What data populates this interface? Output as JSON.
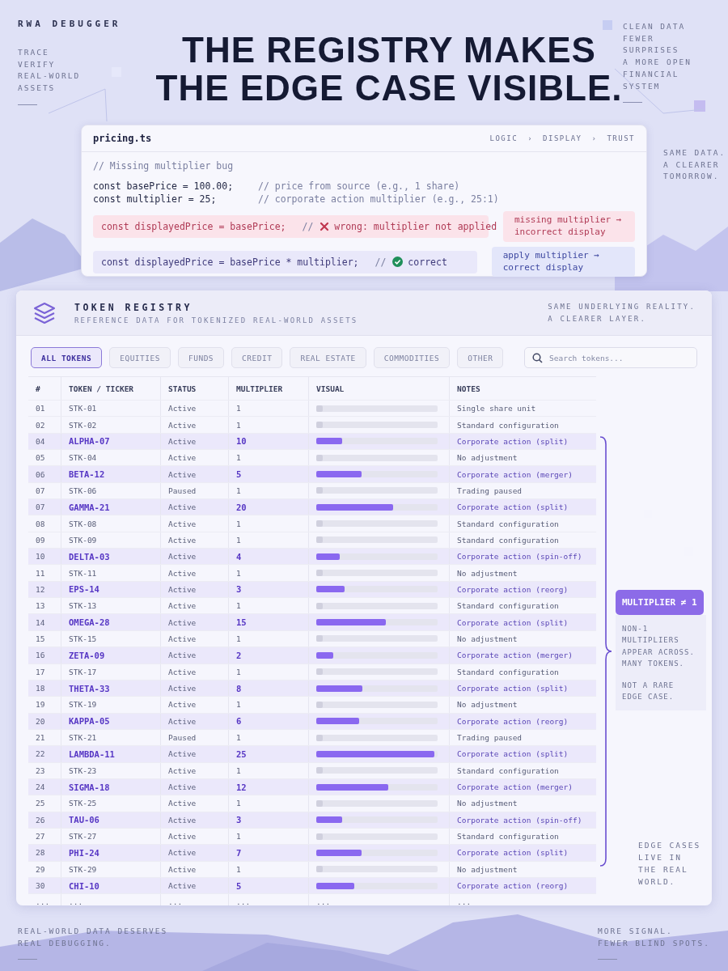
{
  "brand": "RWA DEBUGGER",
  "tagline": "TRACE\nVERIFY\nREAL-WORLD\nASSETS",
  "headline": "THE REGISTRY MAKES\nTHE EDGE CASE VISIBLE.",
  "top_note": "CLEAN DATA\nFEWER SURPRISES\nA MORE OPEN\nFINANCIAL SYSTEM",
  "side_note": "SAME DATA.\nA CLEARER\nTOMORROW.",
  "code_card": {
    "filename": "pricing.ts",
    "breadcrumb": [
      "LOGIC",
      "›",
      "DISPLAY",
      "›",
      "TRUST"
    ],
    "lines": [
      {
        "kind": "comment",
        "code": "// Missing multiplier bug"
      },
      {
        "kind": "plain",
        "code": "const basePrice = 100.00;",
        "comment": "// price from source (e.g., 1 share)"
      },
      {
        "kind": "plain",
        "code": "const multiplier = 25;",
        "comment": "// corporate action multiplier (e.g., 25:1)"
      },
      {
        "kind": "wrong",
        "code": "const displayedPrice = basePrice;",
        "comment_mark": "//",
        "comment": "wrong: multiplier not applied",
        "note": "missing multiplier →\nincorrect display"
      },
      {
        "kind": "correct",
        "code": "const displayedPrice = basePrice * multiplier;",
        "comment_mark": "//",
        "comment": "correct",
        "note": "apply multiplier →\ncorrect display"
      }
    ]
  },
  "registry": {
    "title": "TOKEN REGISTRY",
    "subtitle": "REFERENCE DATA FOR TOKENIZED REAL-WORLD ASSETS",
    "aside": "SAME UNDERLYING REALITY.\nA CLEARER LAYER.",
    "tabs": [
      {
        "label": "ALL TOKENS",
        "selected": true
      },
      {
        "label": "EQUITIES",
        "selected": false
      },
      {
        "label": "FUNDS",
        "selected": false
      },
      {
        "label": "CREDIT",
        "selected": false
      },
      {
        "label": "REAL ESTATE",
        "selected": false
      },
      {
        "label": "COMMODITIES",
        "selected": false
      },
      {
        "label": "OTHER",
        "selected": false
      }
    ],
    "search": {
      "placeholder": "Search tokens..."
    },
    "columns": [
      "#",
      "TOKEN / TICKER",
      "STATUS",
      "MULTIPLIER",
      "VISUAL",
      "NOTES"
    ],
    "rows": [
      {
        "n": "01",
        "token": "STK-01",
        "status": "Active",
        "multiplier": "1",
        "level": 0.05,
        "notes": "Single share unit",
        "flagged": false
      },
      {
        "n": "02",
        "token": "STK-02",
        "status": "Active",
        "multiplier": "1",
        "level": 0.05,
        "notes": "Standard configuration",
        "flagged": false
      },
      {
        "n": "04",
        "token": "ALPHA-07",
        "status": "Active",
        "multiplier": "10",
        "level": 0.21,
        "notes": "Corporate action (split)",
        "flagged": true
      },
      {
        "n": "05",
        "token": "STK-04",
        "status": "Active",
        "multiplier": "1",
        "level": 0.05,
        "notes": "No adjustment",
        "flagged": false
      },
      {
        "n": "06",
        "token": "BETA-12",
        "status": "Active",
        "multiplier": "5",
        "level": 0.37,
        "notes": "Corporate action (merger)",
        "flagged": true
      },
      {
        "n": "07",
        "token": "STK-06",
        "status": "Paused",
        "multiplier": "1",
        "level": 0.05,
        "notes": "Trading paused",
        "flagged": false
      },
      {
        "n": "07",
        "token": "GAMMA-21",
        "status": "Active",
        "multiplier": "20",
        "level": 0.63,
        "notes": "Corporate action (split)",
        "flagged": true
      },
      {
        "n": "08",
        "token": "STK-08",
        "status": "Active",
        "multiplier": "1",
        "level": 0.05,
        "notes": "Standard configuration",
        "flagged": false
      },
      {
        "n": "09",
        "token": "STK-09",
        "status": "Active",
        "multiplier": "1",
        "level": 0.05,
        "notes": "Standard configuration",
        "flagged": false
      },
      {
        "n": "10",
        "token": "DELTA-03",
        "status": "Active",
        "multiplier": "4",
        "level": 0.19,
        "notes": "Corporate action (spin-off)",
        "flagged": true
      },
      {
        "n": "11",
        "token": "STK-11",
        "status": "Active",
        "multiplier": "1",
        "level": 0.05,
        "notes": "No adjustment",
        "flagged": false
      },
      {
        "n": "12",
        "token": "EPS-14",
        "status": "Active",
        "multiplier": "3",
        "level": 0.23,
        "notes": "Corporate action (reorg)",
        "flagged": true
      },
      {
        "n": "13",
        "token": "STK-13",
        "status": "Active",
        "multiplier": "1",
        "level": 0.05,
        "notes": "Standard configuration",
        "flagged": false
      },
      {
        "n": "14",
        "token": "OMEGA-28",
        "status": "Active",
        "multiplier": "15",
        "level": 0.57,
        "notes": "Corporate action (split)",
        "flagged": true
      },
      {
        "n": "15",
        "token": "STK-15",
        "status": "Active",
        "multiplier": "1",
        "level": 0.05,
        "notes": "No adjustment",
        "flagged": false
      },
      {
        "n": "16",
        "token": "ZETA-09",
        "status": "Active",
        "multiplier": "2",
        "level": 0.14,
        "notes": "Corporate action (merger)",
        "flagged": true
      },
      {
        "n": "17",
        "token": "STK-17",
        "status": "Active",
        "multiplier": "1",
        "level": 0.05,
        "notes": "Standard configuration",
        "flagged": false
      },
      {
        "n": "18",
        "token": "THETA-33",
        "status": "Active",
        "multiplier": "8",
        "level": 0.38,
        "notes": "Corporate action (split)",
        "flagged": true
      },
      {
        "n": "19",
        "token": "STK-19",
        "status": "Active",
        "multiplier": "1",
        "level": 0.05,
        "notes": "No adjustment",
        "flagged": false
      },
      {
        "n": "20",
        "token": "KAPPA-05",
        "status": "Active",
        "multiplier": "6",
        "level": 0.35,
        "notes": "Corporate action (reorg)",
        "flagged": true
      },
      {
        "n": "21",
        "token": "STK-21",
        "status": "Paused",
        "multiplier": "1",
        "level": 0.05,
        "notes": "Trading paused",
        "flagged": false
      },
      {
        "n": "22",
        "token": "LAMBDA-11",
        "status": "Active",
        "multiplier": "25",
        "level": 0.97,
        "notes": "Corporate action (split)",
        "flagged": true
      },
      {
        "n": "23",
        "token": "STK-23",
        "status": "Active",
        "multiplier": "1",
        "level": 0.05,
        "notes": "Standard configuration",
        "flagged": false
      },
      {
        "n": "24",
        "token": "SIGMA-18",
        "status": "Active",
        "multiplier": "12",
        "level": 0.59,
        "notes": "Corporate action (merger)",
        "flagged": true
      },
      {
        "n": "25",
        "token": "STK-25",
        "status": "Active",
        "multiplier": "1",
        "level": 0.05,
        "notes": "No adjustment",
        "flagged": false
      },
      {
        "n": "26",
        "token": "TAU-06",
        "status": "Active",
        "multiplier": "3",
        "level": 0.21,
        "notes": "Corporate action (spin-off)",
        "flagged": true
      },
      {
        "n": "27",
        "token": "STK-27",
        "status": "Active",
        "multiplier": "1",
        "level": 0.05,
        "notes": "Standard configuration",
        "flagged": false
      },
      {
        "n": "28",
        "token": "PHI-24",
        "status": "Active",
        "multiplier": "7",
        "level": 0.37,
        "notes": "Corporate action (split)",
        "flagged": true
      },
      {
        "n": "29",
        "token": "STK-29",
        "status": "Active",
        "multiplier": "1",
        "level": 0.05,
        "notes": "No adjustment",
        "flagged": false
      },
      {
        "n": "30",
        "token": "CHI-10",
        "status": "Active",
        "multiplier": "5",
        "level": 0.31,
        "notes": "Corporate action (reorg)",
        "flagged": true
      }
    ],
    "more_row": [
      "...",
      "...",
      "...",
      "...",
      "...",
      "..."
    ],
    "callout": {
      "label": "MULTIPLIER ≠ 1",
      "notes": [
        "NON-1 MULTIPLIERS\nAPPEAR ACROSS.\nMANY TOKENS.",
        "NOT A RARE\nEDGE CASE."
      ]
    },
    "edge_note": "EDGE CASES\nLIVE IN\nTHE REAL\nWORLD."
  },
  "footer": {
    "left": "REAL-WORLD DATA DESERVES\nREAL DEBUGGING.",
    "right": "MORE SIGNAL.\nFEWER BLIND SPOTS."
  }
}
